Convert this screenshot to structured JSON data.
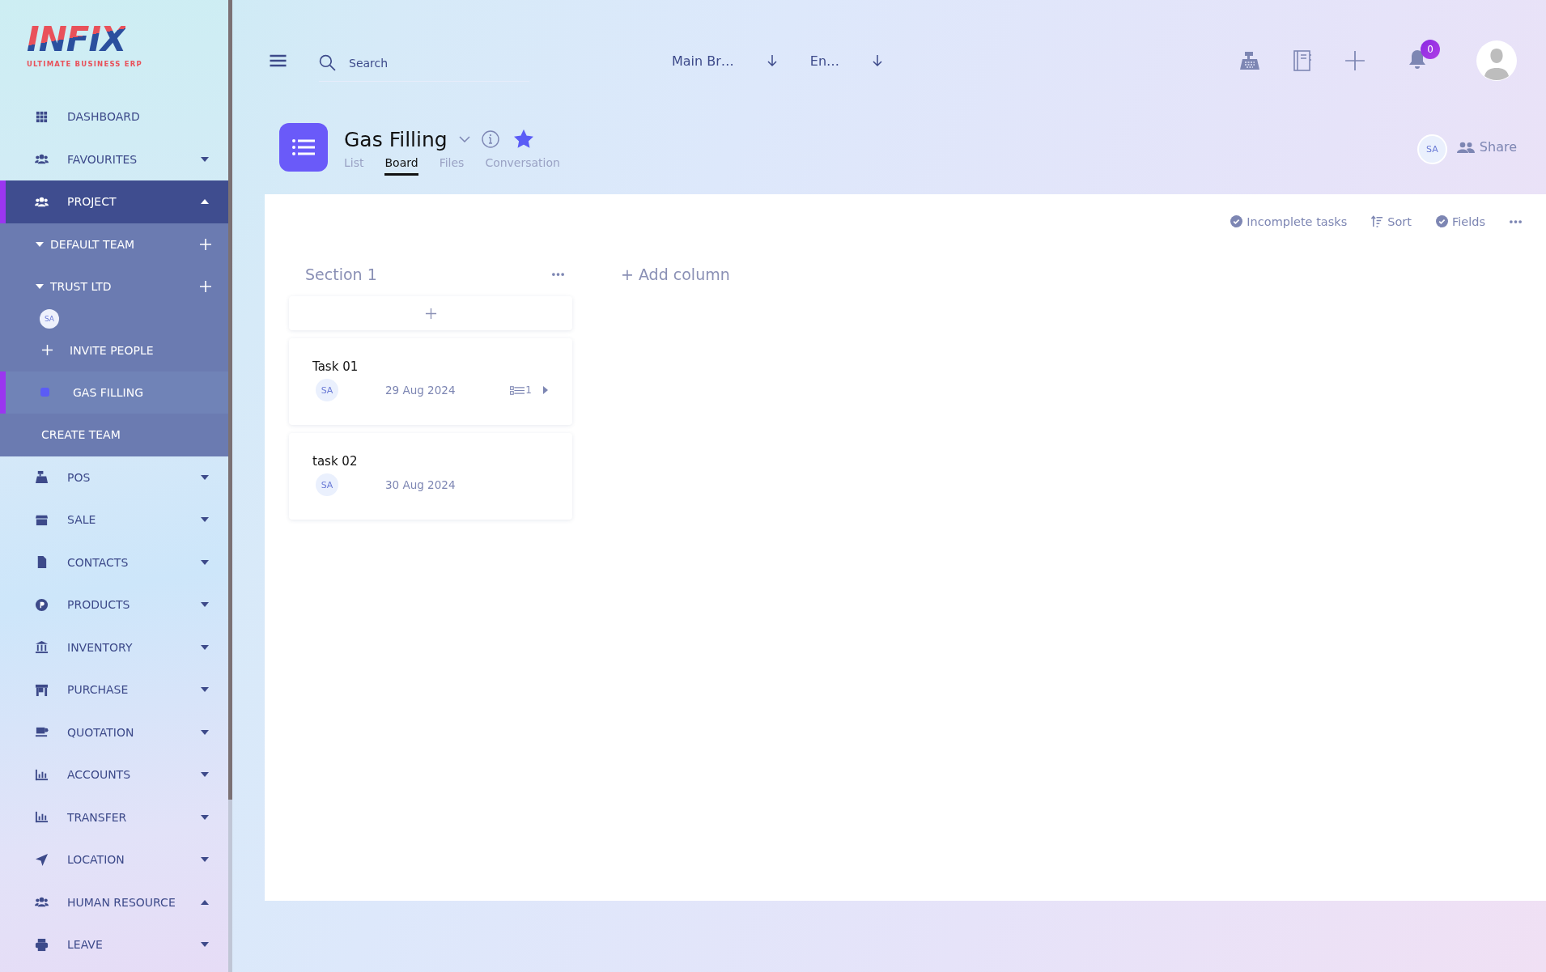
{
  "sidebar": {
    "logo": {
      "wordmark": "INFIX",
      "tagline": "ULTIMATE BUSINESS ERP"
    },
    "items": [
      {
        "kind": "menu",
        "label": "DASHBOARD",
        "selected": false
      },
      {
        "kind": "menu",
        "label": "FAVOURITES",
        "selected": false,
        "expanded": false
      },
      {
        "kind": "project",
        "label": "PROJECT",
        "selected": true,
        "expanded": true,
        "teams": [
          {
            "name": "DEFAULT TEAM",
            "expanded": true
          },
          {
            "name": "TRUST LTD",
            "expanded": true,
            "members": [
              "SA"
            ],
            "invite": "INVITE PEOPLE",
            "projects": [
              {
                "name": "GAS FILLING",
                "selected": true,
                "color": "#5b5cf6"
              }
            ]
          }
        ],
        "create_team": "CREATE TEAM"
      },
      {
        "kind": "menu",
        "label": "POS",
        "selected": false,
        "expanded": false
      },
      {
        "kind": "menu",
        "label": "SALE",
        "selected": false,
        "expanded": false
      },
      {
        "kind": "menu",
        "label": "CONTACTS",
        "selected": false,
        "expanded": false
      },
      {
        "kind": "menu",
        "label": "PRODUCTS",
        "selected": false,
        "expanded": false
      },
      {
        "kind": "menu",
        "label": "INVENTORY",
        "selected": false,
        "expanded": false
      },
      {
        "kind": "menu",
        "label": "PURCHASE",
        "selected": false,
        "expanded": false
      },
      {
        "kind": "menu",
        "label": "QUOTATION",
        "selected": false,
        "expanded": false
      },
      {
        "kind": "menu",
        "label": "ACCOUNTS",
        "selected": false,
        "expanded": false
      },
      {
        "kind": "menu",
        "label": "TRANSFER",
        "selected": false,
        "expanded": false
      },
      {
        "kind": "menu",
        "label": "LOCATION",
        "selected": false,
        "expanded": false
      },
      {
        "kind": "menu",
        "label": "HUMAN RESOURCE",
        "selected": false,
        "expanded": true
      },
      {
        "kind": "menu",
        "label": "LEAVE",
        "selected": false,
        "expanded": false
      }
    ]
  },
  "topbar": {
    "search": {
      "placeholder": "Search"
    },
    "branch": "Main Br…",
    "language": "En…",
    "notifications": "0"
  },
  "project": {
    "title": "Gas Filling",
    "favorite": true,
    "tabs": [
      {
        "label": "List",
        "selected": false
      },
      {
        "label": "Board",
        "selected": true
      },
      {
        "label": "Files",
        "selected": false
      },
      {
        "label": "Conversation",
        "selected": false
      }
    ],
    "members": [
      "SA"
    ],
    "share": "Share"
  },
  "toolbar": {
    "filters": [
      {
        "kind": "check",
        "label": "Incomplete tasks"
      },
      {
        "kind": "sort",
        "label": "Sort"
      },
      {
        "kind": "check",
        "label": "Fields"
      }
    ]
  },
  "board": {
    "columns": [
      {
        "title": "Section 1",
        "tasks": [
          {
            "title": "Task 01",
            "assignee": "SA",
            "date": "29 Aug 2024",
            "subtask_count": "1"
          },
          {
            "title": "task 02",
            "assignee": "SA",
            "date": "30 Aug 2024"
          }
        ]
      }
    ],
    "add_column": "+ Add column"
  }
}
